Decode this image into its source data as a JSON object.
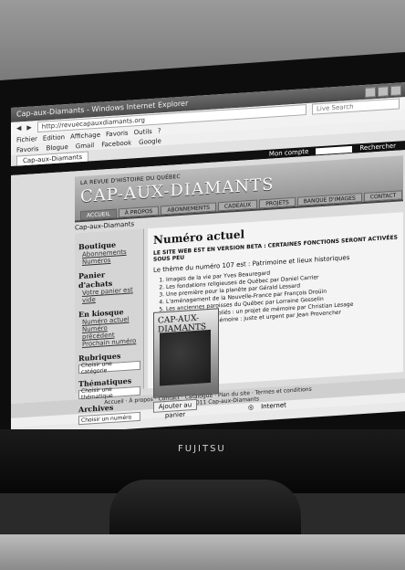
{
  "browser": {
    "window_title": "Cap-aux-Diamants - Windows Internet Explorer",
    "address": "http://revuecapauxdiamants.org",
    "search_placeholder": "Live Search",
    "menu": [
      "Fichier",
      "Edition",
      "Affichage",
      "Favoris",
      "Outils",
      "?"
    ],
    "favorites": [
      "Favoris",
      "Blogue",
      "Gmail",
      "Facebook",
      "Google"
    ],
    "tab": "Cap-aux-Diamants",
    "status_zone": "Internet"
  },
  "site": {
    "account_label": "Mon compte",
    "search_label": "Rechercher",
    "tagline": "LA REVUE D'HISTOIRE DU QUÉBEC",
    "logo": "CAP-AUX-DIAMANTS",
    "nav": [
      "ACCUEIL",
      "À PROPOS",
      "ABONNEMENTS",
      "CADEAUX",
      "PROJETS",
      "BANQUE D'IMAGES",
      "CONTACT"
    ],
    "breadcrumb": "Cap-aux-Diamants"
  },
  "sidebar": {
    "sections": [
      {
        "title": "Boutique",
        "links": [
          "Abonnements",
          "Numéros"
        ]
      },
      {
        "title": "Panier d'achats",
        "links": [
          "Votre panier est vide"
        ]
      },
      {
        "title": "En kiosque",
        "links": [
          "Numéro actuel",
          "Numéro précédent",
          "Prochain numéro"
        ]
      },
      {
        "title": "Rubriques",
        "select": "Choisir une catégorie"
      },
      {
        "title": "Thématiques",
        "select": "Choisir une thématique"
      },
      {
        "title": "Archives",
        "select": "Choisir un numéro"
      }
    ]
  },
  "content": {
    "heading": "Numéro actuel",
    "notice": "LE SITE WEB EST EN VERSION BETA : CERTAINES FONCTIONS SERONT ACTIVÉES SOUS PEU",
    "intro": "Le thème du numéro 107 est : Patrimoine et lieux historiques",
    "items": [
      "Images de la vie par Yves Beauregard",
      "Les fondations religieuses de Québec par Daniel Carrier",
      "Une première pour la planète par Gérald Lessard",
      "L'aménagement de la Nouvelle-France par François Droüin",
      "Les anciennes paroisses du Québec par Lorraine Gosselin",
      "Les lieux sacrés oubliés : un projet de mémoire par Christian Lesage",
      "Pour le devoir de mémoire : juste et urgent par Jean Provencher"
    ],
    "cover_title": "CAP-AUX-DIAMANTS",
    "add_to_cart": "Ajouter au panier"
  },
  "footer": {
    "links": "Accueil · À propos · Contact · Catalogue · Plan du site · Termes et conditions",
    "copyright": "Copyright © 2011 Cap-aux-Diamants"
  },
  "monitor_brand": "FUJITSU"
}
